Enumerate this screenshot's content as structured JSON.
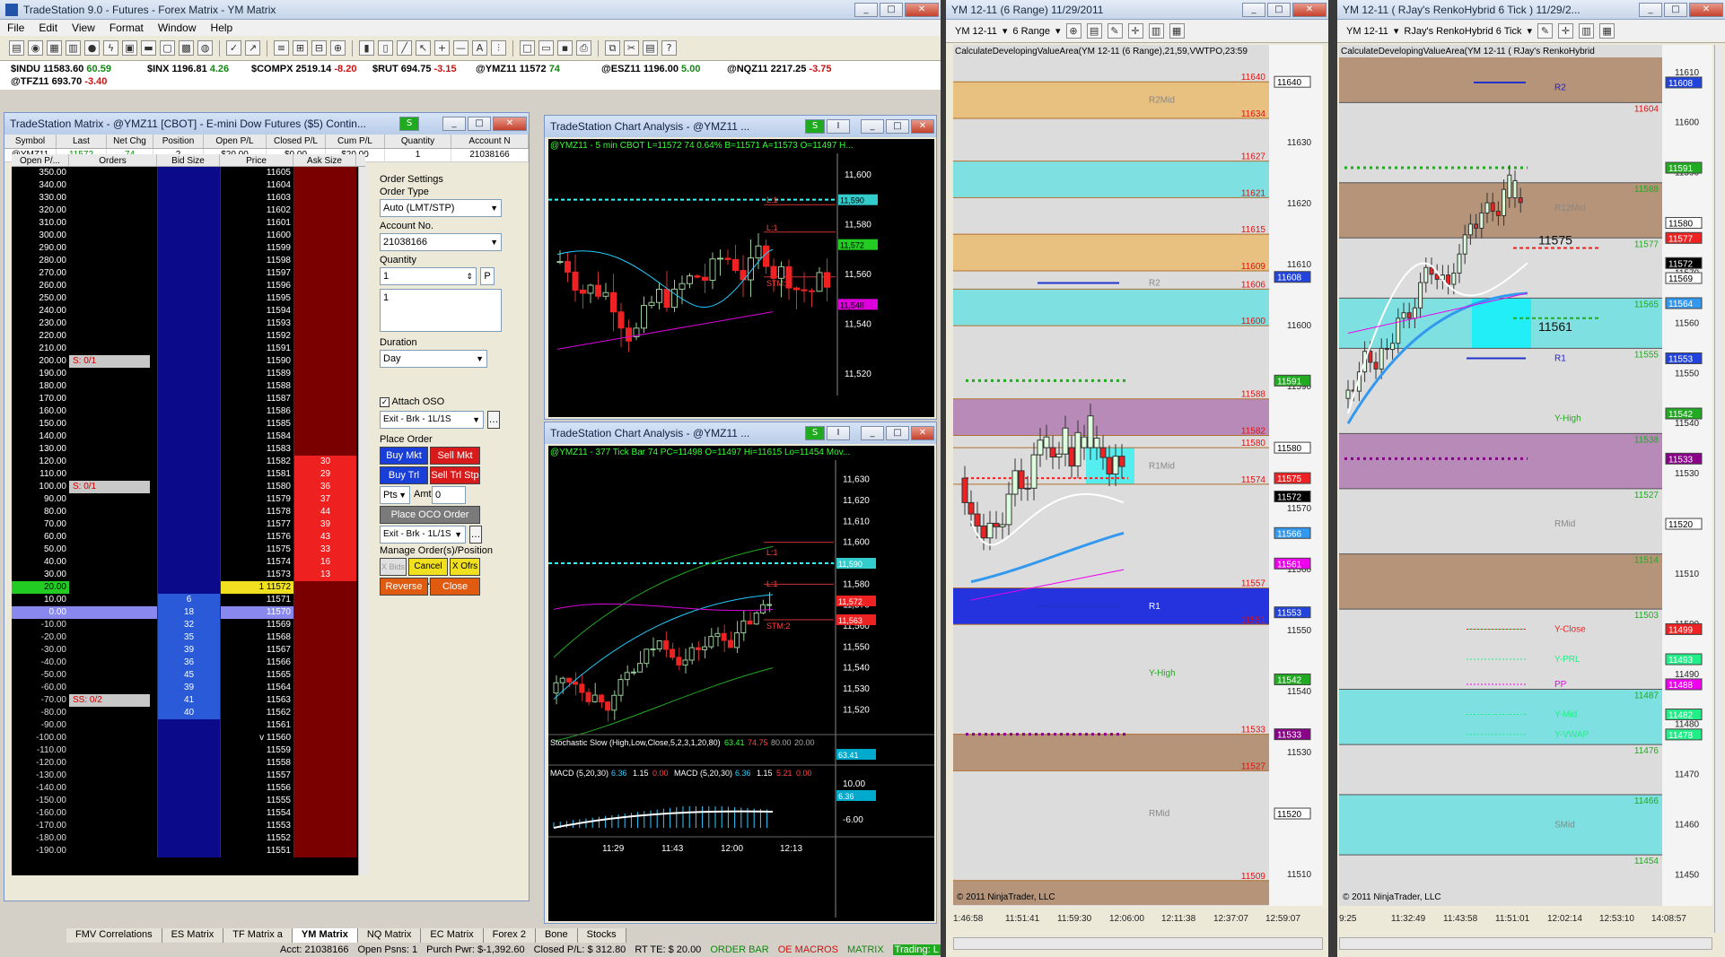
{
  "app": {
    "title": "TradeStation 9.0 - Futures - Forex Matrix - YM Matrix",
    "menu": [
      "File",
      "Edit",
      "View",
      "Format",
      "Window",
      "Help"
    ]
  },
  "ticker": [
    {
      "sym": "$INDU",
      "last": "11583.60",
      "chg": "60.59",
      "dir": "up"
    },
    {
      "sym": "$INX",
      "last": "1196.81",
      "chg": "4.26",
      "dir": "up"
    },
    {
      "sym": "$COMPX",
      "last": "2519.14",
      "chg": "-8.20",
      "dir": "dn"
    },
    {
      "sym": "$RUT",
      "last": "694.75",
      "chg": "-3.15",
      "dir": "dn"
    },
    {
      "sym": "@YMZ11",
      "last": "11572",
      "chg": "74",
      "dir": "up"
    },
    {
      "sym": "@ESZ11",
      "last": "1196.00",
      "chg": "5.00",
      "dir": "up"
    },
    {
      "sym": "@NQZ11",
      "last": "2217.25",
      "chg": "-3.75",
      "dir": "dn"
    },
    {
      "sym": "@TFZ11",
      "last": "693.70",
      "chg": "-3.40",
      "dir": "dn"
    }
  ],
  "matrix": {
    "title": "TradeStation Matrix - @YMZ11 [CBOT] - E-mini Dow Futures ($5) Contin...",
    "columns": [
      "Symbol",
      "Last",
      "Net Chg",
      "Position",
      "Open P/L",
      "Closed P/L",
      "Cum P/L",
      "Quantity",
      "Account N"
    ],
    "row": [
      "@YMZ11",
      "11572",
      "74",
      "2",
      "$20.00",
      "$0.00",
      "$20.00",
      "1",
      "21038166"
    ],
    "ladder_headers": [
      "Open P/...",
      "Orders",
      "Bid Size",
      "Price",
      "Ask Size"
    ],
    "ladder": [
      [
        "350.00",
        "",
        "",
        "11605",
        ""
      ],
      [
        "340.00",
        "",
        "",
        "11604",
        ""
      ],
      [
        "330.00",
        "",
        "",
        "11603",
        ""
      ],
      [
        "320.00",
        "",
        "",
        "11602",
        ""
      ],
      [
        "310.00",
        "",
        "",
        "11601",
        ""
      ],
      [
        "300.00",
        "",
        "",
        "11600",
        ""
      ],
      [
        "290.00",
        "",
        "",
        "11599",
        ""
      ],
      [
        "280.00",
        "",
        "",
        "11598",
        ""
      ],
      [
        "270.00",
        "",
        "",
        "11597",
        ""
      ],
      [
        "260.00",
        "",
        "",
        "11596",
        ""
      ],
      [
        "250.00",
        "",
        "",
        "11595",
        ""
      ],
      [
        "240.00",
        "",
        "",
        "11594",
        ""
      ],
      [
        "230.00",
        "",
        "",
        "11593",
        ""
      ],
      [
        "220.00",
        "",
        "",
        "11592",
        ""
      ],
      [
        "210.00",
        "",
        "",
        "11591",
        ""
      ],
      [
        "200.00",
        "S: 0/1",
        "",
        "11590",
        ""
      ],
      [
        "190.00",
        "",
        "",
        "11589",
        ""
      ],
      [
        "180.00",
        "",
        "",
        "11588",
        ""
      ],
      [
        "170.00",
        "",
        "",
        "11587",
        ""
      ],
      [
        "160.00",
        "",
        "",
        "11586",
        ""
      ],
      [
        "150.00",
        "",
        "",
        "11585",
        ""
      ],
      [
        "140.00",
        "",
        "",
        "11584",
        ""
      ],
      [
        "130.00",
        "",
        "",
        "11583",
        ""
      ],
      [
        "120.00",
        "",
        "",
        "11582",
        "30"
      ],
      [
        "110.00",
        "",
        "",
        "11581",
        "29"
      ],
      [
        "100.00",
        "S: 0/1",
        "",
        "11580",
        "36"
      ],
      [
        "90.00",
        "",
        "",
        "11579",
        "37"
      ],
      [
        "80.00",
        "",
        "",
        "11578",
        "44"
      ],
      [
        "70.00",
        "",
        "",
        "11577",
        "39"
      ],
      [
        "60.00",
        "",
        "",
        "11576",
        "43"
      ],
      [
        "50.00",
        "",
        "",
        "11575",
        "33"
      ],
      [
        "40.00",
        "",
        "",
        "11574",
        "16"
      ],
      [
        "30.00",
        "",
        "",
        "11573",
        "13"
      ],
      [
        "20.00",
        "",
        "",
        "1  11572",
        ""
      ],
      [
        "10.00",
        "",
        "6",
        "11571",
        ""
      ],
      [
        "0.00",
        "",
        "18",
        "11570",
        ""
      ],
      [
        "-10.00",
        "",
        "32",
        "11569",
        ""
      ],
      [
        "-20.00",
        "",
        "35",
        "11568",
        ""
      ],
      [
        "-30.00",
        "",
        "39",
        "11567",
        ""
      ],
      [
        "-40.00",
        "",
        "36",
        "11566",
        ""
      ],
      [
        "-50.00",
        "",
        "45",
        "11565",
        ""
      ],
      [
        "-60.00",
        "",
        "39",
        "11564",
        ""
      ],
      [
        "-70.00",
        "SS: 0/2",
        "41",
        "11563",
        ""
      ],
      [
        "-80.00",
        "",
        "40",
        "11562",
        ""
      ],
      [
        "-90.00",
        "",
        "",
        "11561",
        ""
      ],
      [
        "-100.00",
        "",
        "",
        "v 11560",
        ""
      ],
      [
        "-110.00",
        "",
        "",
        "11559",
        ""
      ],
      [
        "-120.00",
        "",
        "",
        "11558",
        ""
      ],
      [
        "-130.00",
        "",
        "",
        "11557",
        ""
      ],
      [
        "-140.00",
        "",
        "",
        "11556",
        ""
      ],
      [
        "-150.00",
        "",
        "",
        "11555",
        ""
      ],
      [
        "-160.00",
        "",
        "",
        "11554",
        ""
      ],
      [
        "-170.00",
        "",
        "",
        "11553",
        ""
      ],
      [
        "-180.00",
        "",
        "",
        "11552",
        ""
      ],
      [
        "-190.00",
        "",
        "",
        "11551",
        ""
      ]
    ],
    "order_settings": {
      "title": "Order Settings",
      "order_type_label": "Order Type",
      "order_type": "Auto (LMT/STP)",
      "account_label": "Account No.",
      "account": "21038166",
      "quantity_label": "Quantity",
      "quantity": "1",
      "quantity_list": "1",
      "duration_label": "Duration",
      "duration": "Day",
      "attach_oso": "Attach OSO",
      "oso_strategy": "Exit - Brk - 1L/1S",
      "place_order": "Place Order",
      "buy_mkt": "Buy Mkt",
      "sell_mkt": "Sell Mkt",
      "buy_trl": "Buy Trl Stp",
      "sell_trl": "Sell Trl Stp",
      "pts": "Pts",
      "amt_label": "Amt",
      "amt": "0",
      "place_oco": "Place OCO Order",
      "oco_strategy": "Exit - Brk - 1L/1S",
      "manage": "Manage Order(s)/Position",
      "x_bids": "X Bids",
      "cancel_all": "Cancel All",
      "x_ofrs": "X Ofrs",
      "reverse": "Reverse",
      "close": "Close"
    }
  },
  "tabs": [
    "FMV Correlations",
    "ES Matrix",
    "TF Matrix a",
    "YM Matrix",
    "NQ Matrix",
    "EC Matrix",
    "Forex 2",
    "Bone",
    "Stocks"
  ],
  "status": [
    "Acct: 21038166",
    "Open Psns: 1",
    "Purch Pwr: $-1,392.60",
    "Closed P/L: $ 312.80",
    "RT TE: $ 20.00",
    "ORDER BAR",
    "OE MACROS",
    "MATRIX",
    "Trading: L"
  ],
  "chart1": {
    "title": "TradeStation Chart Analysis - @YMZ11 ...",
    "info": "@YMZ11 - 5 min  CBOT  L=11572  74  0.64%  B=11571  A=11573  O=11497  H...",
    "axis": [
      "11,600",
      "11,580",
      "11,560",
      "11,540",
      "11,520"
    ],
    "tags": {
      "L1a": "L:1",
      "L1b": "L:1",
      "stm": "STM:2",
      "p1": "11,590",
      "p2": "11,572",
      "p3": "11,548"
    }
  },
  "chart2": {
    "title": "TradeStation Chart Analysis - @YMZ11 ...",
    "info": "@YMZ11 - 377 Tick Bar  74  PC=11498  O=11497  Hi=11615  Lo=11454  Mov...",
    "axis": [
      "11,630",
      "11,620",
      "11,610",
      "11,600",
      "11,590",
      "11,580",
      "11,570",
      "11,560",
      "11,550",
      "11,540",
      "11,530",
      "11,520"
    ],
    "tags": {
      "L1a": "L:1",
      "L1b": "L:1",
      "stm": "STM:2",
      "p1": "11,590",
      "p2": "11,572",
      "p3": "11,563"
    },
    "stoch": "Stochastic Slow (High,Low,Close,5,2,3,1,20,80)",
    "stoch_vals": [
      "63.41",
      "74.75",
      "80.00",
      "20.00"
    ],
    "stoch_tag": "63.41",
    "macd": "MACD (5,20,30)",
    "macd_vals": [
      "6.36",
      "1.15",
      "0.00"
    ],
    "macd_right": "MACD (5,20,30)",
    "macd_right_vals": [
      "6.36",
      "1.15",
      "5.21",
      "0.00"
    ],
    "macd_axis": [
      "10.00",
      "6.36",
      "-6.00"
    ],
    "time": [
      "11:29",
      "11:43",
      "12:00",
      "12:13"
    ]
  },
  "nt1": {
    "title": "YM 12-11 (6 Range)  11/29/2011",
    "inst": "YM 12-11",
    "type": "6 Range",
    "indicator": "CalculateDevelopingValueArea(YM 12-11 (6 Range),21,59,VWTPO,23:59",
    "copyright": "© 2011 NinjaTrader, LLC",
    "axis": [
      "11630",
      "11620",
      "11610",
      "11600",
      "11590",
      "11580",
      "11570",
      "11560",
      "11550",
      "11540",
      "11530",
      "11520",
      "11510"
    ],
    "levels": [
      "11640",
      "11634",
      "11627",
      "11621",
      "11615",
      "11609",
      "11606",
      "11600",
      "11588",
      "11582",
      "11580",
      "11574",
      "11557",
      "11551",
      "11533",
      "11527",
      "11509"
    ],
    "pills": [
      "11640",
      "11608",
      "11591",
      "11580",
      "11575",
      "11572",
      "11566",
      "11561",
      "11553",
      "11542",
      "11533",
      "11520"
    ],
    "names": [
      "R2Mid",
      "R2",
      "R1Mid",
      "R1",
      "Y-High",
      "RMid"
    ],
    "time": [
      "1:46:58",
      "11:51:41",
      "11:59:30",
      "12:06:00",
      "12:11:38",
      "12:37:07",
      "12:59:07"
    ]
  },
  "nt2": {
    "title": "YM 12-11 ( RJay's RenkoHybrid  6 Tick )  11/29/2...",
    "inst": "YM 12-11",
    "type": "RJay's RenkoHybrid  6 Tick",
    "indicator": "CalculateDevelopingValueArea(YM 12-11 ( RJay's RenkoHybrid",
    "copyright": "© 2011 NinjaTrader, LLC",
    "axis": [
      "11610",
      "11600",
      "11590",
      "11580",
      "11570",
      "11560",
      "11550",
      "11540",
      "11530",
      "11520",
      "11510",
      "11500",
      "11490",
      "11480",
      "11470",
      "11460",
      "11450"
    ],
    "levels": [
      "11604",
      "11588",
      "11577",
      "11565",
      "11555",
      "11538",
      "11527",
      "11514",
      "11503",
      "11487",
      "11476",
      "11466",
      "11454"
    ],
    "pills": [
      "11608",
      "11591",
      "11580",
      "11577",
      "11572",
      "11569",
      "11564",
      "11553",
      "11542",
      "11533",
      "11520",
      "11499",
      "11493",
      "11488",
      "11482",
      "11478"
    ],
    "names": [
      "R2",
      "R12Mid",
      "R1",
      "Y-High",
      "RMid",
      "Y-Close",
      "Y-PRL",
      "PP",
      "Y-Mid",
      "Y-VWAP",
      "SMid"
    ],
    "big1": "11575",
    "big2": "11561",
    "time": [
      "9:25",
      "11:32:49",
      "11:43:58",
      "11:51:01",
      "12:02:14",
      "12:53:10",
      "14:08:57"
    ]
  },
  "colors": {
    "accent": "#1a3fd8",
    "up": "#118811",
    "down": "#cc1111",
    "cyan": "#66e0e0",
    "tan": "#e8c080",
    "brown": "#b08c6a",
    "purple": "#a070a0"
  }
}
